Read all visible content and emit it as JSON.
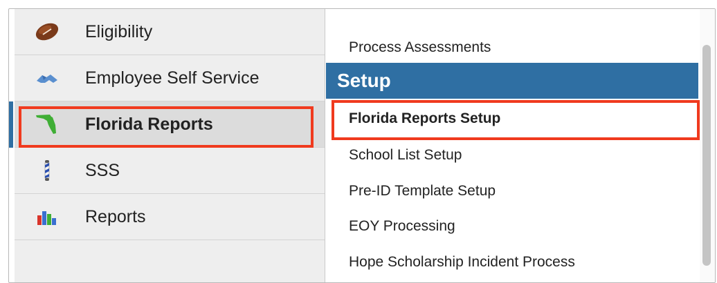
{
  "sidebar": {
    "items": [
      {
        "label": "Eligibility",
        "icon": "football-icon"
      },
      {
        "label": "Employee Self Service",
        "icon": "handshake-icon"
      },
      {
        "label": "Florida Reports",
        "icon": "florida-map-icon",
        "active": true
      },
      {
        "label": "SSS",
        "icon": "barber-pole-icon"
      },
      {
        "label": "Reports",
        "icon": "bar-chart-icon"
      }
    ]
  },
  "menu": {
    "process_assessments": "Process Assessments",
    "section_title": "Setup",
    "items": [
      {
        "label": "Florida Reports Setup",
        "selected": true
      },
      {
        "label": "School List Setup"
      },
      {
        "label": "Pre-ID Template Setup"
      },
      {
        "label": "EOY Processing"
      },
      {
        "label": "Hope Scholarship Incident Process"
      }
    ]
  },
  "colors": {
    "accent": "#2f6fa3",
    "highlight": "#f03a1e",
    "sidebar_bg": "#eeeeee",
    "active_bg": "#dcdcdc"
  }
}
